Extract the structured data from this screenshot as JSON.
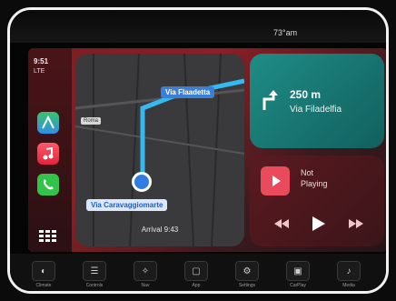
{
  "status_bar": {
    "temperature": "73°am"
  },
  "left_rail": {
    "time": "9:51",
    "signal": "LTE",
    "apps": [
      {
        "icon": "maps-icon"
      },
      {
        "icon": "music-icon"
      },
      {
        "icon": "phone-icon"
      },
      {
        "icon": "app-grid-icon"
      }
    ]
  },
  "map": {
    "street_label": "Via Flaadetta",
    "small_label": "Roma",
    "current_street": "Via Caravaggiomarte",
    "arrival": "Arrival 9:43",
    "route_color": "#35b9f0"
  },
  "navigation": {
    "distance": "250 m",
    "street": "Via Filadelfia",
    "card_color": "#1f8c86"
  },
  "media": {
    "line1": "Not",
    "line2": "Playing",
    "accent_color": "#e94b5c"
  },
  "bottom_bar": {
    "buttons": [
      {
        "label": "Climate",
        "glyph": "◐"
      },
      {
        "label": "Controls",
        "glyph": "☰"
      },
      {
        "label": "Nav",
        "glyph": "✧"
      },
      {
        "label": "App",
        "glyph": "▢"
      },
      {
        "label": "Settings",
        "glyph": "⚙"
      },
      {
        "label": "CarPlay",
        "glyph": "▣"
      },
      {
        "label": "Media",
        "glyph": "♪"
      }
    ]
  }
}
